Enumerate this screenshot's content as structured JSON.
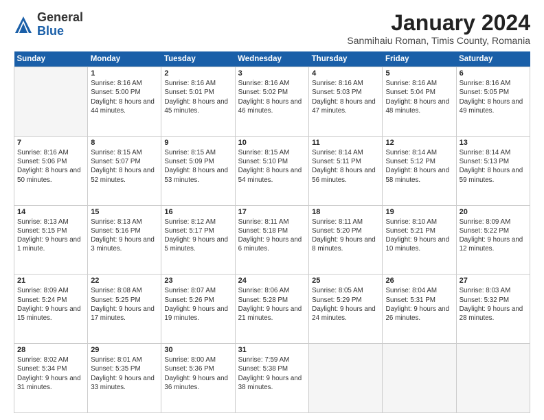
{
  "header": {
    "logo_general": "General",
    "logo_blue": "Blue",
    "title": "January 2024",
    "location": "Sanmihaiu Roman, Timis County, Romania"
  },
  "weekdays": [
    "Sunday",
    "Monday",
    "Tuesday",
    "Wednesday",
    "Thursday",
    "Friday",
    "Saturday"
  ],
  "weeks": [
    [
      {
        "day": "",
        "empty": true
      },
      {
        "day": "1",
        "sunrise": "8:16 AM",
        "sunset": "5:00 PM",
        "daylight": "8 hours and 44 minutes."
      },
      {
        "day": "2",
        "sunrise": "8:16 AM",
        "sunset": "5:01 PM",
        "daylight": "8 hours and 45 minutes."
      },
      {
        "day": "3",
        "sunrise": "8:16 AM",
        "sunset": "5:02 PM",
        "daylight": "8 hours and 46 minutes."
      },
      {
        "day": "4",
        "sunrise": "8:16 AM",
        "sunset": "5:03 PM",
        "daylight": "8 hours and 47 minutes."
      },
      {
        "day": "5",
        "sunrise": "8:16 AM",
        "sunset": "5:04 PM",
        "daylight": "8 hours and 48 minutes."
      },
      {
        "day": "6",
        "sunrise": "8:16 AM",
        "sunset": "5:05 PM",
        "daylight": "8 hours and 49 minutes."
      }
    ],
    [
      {
        "day": "7",
        "sunrise": "8:16 AM",
        "sunset": "5:06 PM",
        "daylight": "8 hours and 50 minutes."
      },
      {
        "day": "8",
        "sunrise": "8:15 AM",
        "sunset": "5:07 PM",
        "daylight": "8 hours and 52 minutes."
      },
      {
        "day": "9",
        "sunrise": "8:15 AM",
        "sunset": "5:09 PM",
        "daylight": "8 hours and 53 minutes."
      },
      {
        "day": "10",
        "sunrise": "8:15 AM",
        "sunset": "5:10 PM",
        "daylight": "8 hours and 54 minutes."
      },
      {
        "day": "11",
        "sunrise": "8:14 AM",
        "sunset": "5:11 PM",
        "daylight": "8 hours and 56 minutes."
      },
      {
        "day": "12",
        "sunrise": "8:14 AM",
        "sunset": "5:12 PM",
        "daylight": "8 hours and 58 minutes."
      },
      {
        "day": "13",
        "sunrise": "8:14 AM",
        "sunset": "5:13 PM",
        "daylight": "8 hours and 59 minutes."
      }
    ],
    [
      {
        "day": "14",
        "sunrise": "8:13 AM",
        "sunset": "5:15 PM",
        "daylight": "9 hours and 1 minute."
      },
      {
        "day": "15",
        "sunrise": "8:13 AM",
        "sunset": "5:16 PM",
        "daylight": "9 hours and 3 minutes."
      },
      {
        "day": "16",
        "sunrise": "8:12 AM",
        "sunset": "5:17 PM",
        "daylight": "9 hours and 5 minutes."
      },
      {
        "day": "17",
        "sunrise": "8:11 AM",
        "sunset": "5:18 PM",
        "daylight": "9 hours and 6 minutes."
      },
      {
        "day": "18",
        "sunrise": "8:11 AM",
        "sunset": "5:20 PM",
        "daylight": "9 hours and 8 minutes."
      },
      {
        "day": "19",
        "sunrise": "8:10 AM",
        "sunset": "5:21 PM",
        "daylight": "9 hours and 10 minutes."
      },
      {
        "day": "20",
        "sunrise": "8:09 AM",
        "sunset": "5:22 PM",
        "daylight": "9 hours and 12 minutes."
      }
    ],
    [
      {
        "day": "21",
        "sunrise": "8:09 AM",
        "sunset": "5:24 PM",
        "daylight": "9 hours and 15 minutes."
      },
      {
        "day": "22",
        "sunrise": "8:08 AM",
        "sunset": "5:25 PM",
        "daylight": "9 hours and 17 minutes."
      },
      {
        "day": "23",
        "sunrise": "8:07 AM",
        "sunset": "5:26 PM",
        "daylight": "9 hours and 19 minutes."
      },
      {
        "day": "24",
        "sunrise": "8:06 AM",
        "sunset": "5:28 PM",
        "daylight": "9 hours and 21 minutes."
      },
      {
        "day": "25",
        "sunrise": "8:05 AM",
        "sunset": "5:29 PM",
        "daylight": "9 hours and 24 minutes."
      },
      {
        "day": "26",
        "sunrise": "8:04 AM",
        "sunset": "5:31 PM",
        "daylight": "9 hours and 26 minutes."
      },
      {
        "day": "27",
        "sunrise": "8:03 AM",
        "sunset": "5:32 PM",
        "daylight": "9 hours and 28 minutes."
      }
    ],
    [
      {
        "day": "28",
        "sunrise": "8:02 AM",
        "sunset": "5:34 PM",
        "daylight": "9 hours and 31 minutes."
      },
      {
        "day": "29",
        "sunrise": "8:01 AM",
        "sunset": "5:35 PM",
        "daylight": "9 hours and 33 minutes."
      },
      {
        "day": "30",
        "sunrise": "8:00 AM",
        "sunset": "5:36 PM",
        "daylight": "9 hours and 36 minutes."
      },
      {
        "day": "31",
        "sunrise": "7:59 AM",
        "sunset": "5:38 PM",
        "daylight": "9 hours and 38 minutes."
      },
      {
        "day": "",
        "empty": true
      },
      {
        "day": "",
        "empty": true
      },
      {
        "day": "",
        "empty": true
      }
    ]
  ],
  "daylight_label": "Daylight:",
  "sunrise_label": "Sunrise:",
  "sunset_label": "Sunset:"
}
